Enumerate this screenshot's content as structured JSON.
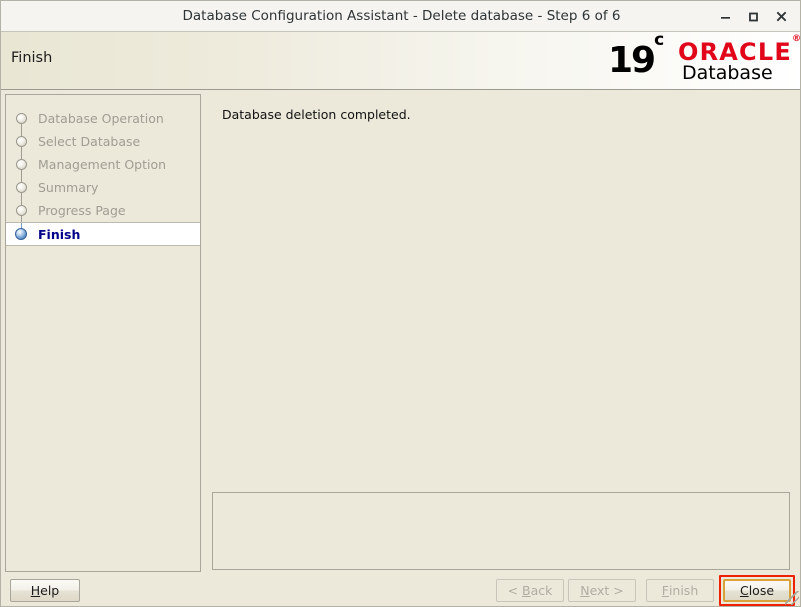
{
  "window": {
    "title": "Database Configuration Assistant - Delete database - Step 6 of 6",
    "minimize_label": "Minimize",
    "maximize_label": "Maximize",
    "close_label": "Close"
  },
  "header": {
    "page_title": "Finish",
    "logo": {
      "version": "19",
      "version_suffix": "c",
      "brand": "ORACLE",
      "brand_mark": "®",
      "product": "Database",
      "brand_color": "#e1061a"
    }
  },
  "sidebar": {
    "steps": [
      {
        "label": "Database Operation",
        "state": "done"
      },
      {
        "label": "Select Database",
        "state": "done"
      },
      {
        "label": "Management Option",
        "state": "done"
      },
      {
        "label": "Summary",
        "state": "done"
      },
      {
        "label": "Progress Page",
        "state": "done"
      },
      {
        "label": "Finish",
        "state": "active"
      }
    ]
  },
  "content": {
    "message": "Database deletion completed.",
    "message_panel_text": ""
  },
  "buttons": {
    "help": {
      "label": "Help",
      "mnemonic": "H",
      "enabled": true
    },
    "back": {
      "label": "< Back",
      "mnemonic": "B",
      "enabled": false
    },
    "next": {
      "label": "Next >",
      "mnemonic": "N",
      "enabled": false
    },
    "finish": {
      "label": "Finish",
      "mnemonic": "F",
      "enabled": false
    },
    "close": {
      "label": "Close",
      "mnemonic": "C",
      "enabled": true,
      "focused": true,
      "focus_ring_color": "#ee2200"
    }
  }
}
